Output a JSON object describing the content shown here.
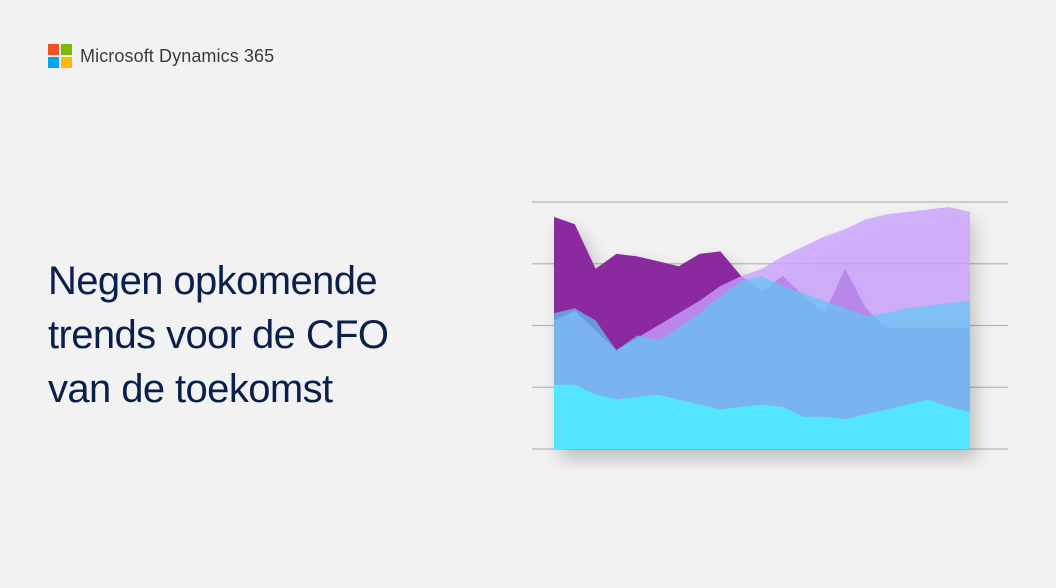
{
  "brand": {
    "name": "Microsoft Dynamics 365",
    "logo_colors": [
      "#f25022",
      "#7fba00",
      "#00a4ef",
      "#ffb900"
    ]
  },
  "headline": {
    "lines": [
      "Negen opkomende",
      "trends voor de CFO",
      "van de toekomst"
    ]
  },
  "chart_data": {
    "type": "area",
    "title": "",
    "xlabel": "",
    "ylabel": "",
    "grid": true,
    "gridlines": 5,
    "ylim": [
      0,
      100
    ],
    "x": [
      0,
      1,
      2,
      3,
      4,
      5,
      6,
      7,
      8,
      9,
      10,
      11,
      12,
      13,
      14,
      15,
      16,
      17,
      18,
      19,
      20
    ],
    "series": [
      {
        "color": "#8a2a9e",
        "values": [
          94,
          91,
          73,
          79,
          78,
          76,
          74,
          79,
          80,
          70,
          64,
          70,
          62,
          55,
          73,
          57,
          49,
          49,
          49,
          49,
          49
        ]
      },
      {
        "color": "#c9a0ff",
        "values": [
          52,
          56,
          48,
          40,
          45,
          50,
          55,
          60,
          66,
          70,
          73,
          78,
          82,
          86,
          89,
          93,
          95,
          96,
          97,
          98,
          96
        ]
      },
      {
        "color": "#5ec8f2",
        "values": [
          55,
          57,
          52,
          40,
          46,
          44,
          49,
          55,
          62,
          68,
          70,
          66,
          63,
          60,
          57,
          54,
          55,
          57,
          58,
          59,
          60
        ]
      },
      {
        "color": "#54e6ff",
        "values": [
          26,
          26,
          22,
          20,
          21,
          22,
          20,
          18,
          16,
          17,
          18,
          17,
          13,
          13,
          12,
          14,
          16,
          18,
          20,
          17,
          15
        ]
      }
    ]
  }
}
